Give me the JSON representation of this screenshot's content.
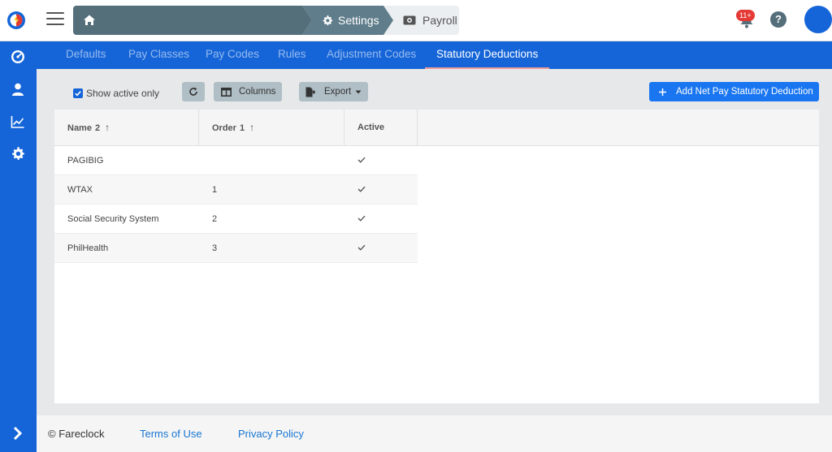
{
  "header": {
    "breadcrumb": [
      {
        "label": "",
        "icon": "home-icon"
      },
      {
        "label": "Settings",
        "icon": "gear-icon"
      },
      {
        "label": "Payroll",
        "icon": "money-icon"
      }
    ],
    "notifications_badge": "11+",
    "help_label": "?"
  },
  "sidebar": {
    "items": [
      {
        "icon": "dashboard-icon"
      },
      {
        "icon": "user-icon"
      },
      {
        "icon": "reports-chart-icon"
      },
      {
        "icon": "settings-gear-icon"
      }
    ],
    "expand_icon": "chevron-right-icon"
  },
  "tabs": [
    {
      "label": "Defaults",
      "active": false
    },
    {
      "label": "Pay Classes",
      "active": false
    },
    {
      "label": "Pay Codes",
      "active": false
    },
    {
      "label": "Rules",
      "active": false
    },
    {
      "label": "Adjustment Codes",
      "active": false
    },
    {
      "label": "Statutory Deductions",
      "active": true
    }
  ],
  "toolbar": {
    "show_active_label": "Show active only",
    "show_active_checked": true,
    "columns_label": "Columns",
    "export_label": "Export",
    "add_label": "Add Net Pay Statutory Deduction"
  },
  "grid": {
    "columns": [
      {
        "label": "Name",
        "sort_rank": "2",
        "sort_dir": "asc"
      },
      {
        "label": "Order",
        "sort_rank": "1",
        "sort_dir": "asc"
      },
      {
        "label": "Active",
        "sort_rank": "",
        "sort_dir": ""
      }
    ],
    "rows": [
      {
        "name": "PAGIBIG",
        "order": "",
        "active": true
      },
      {
        "name": "WTAX",
        "order": "1",
        "active": true
      },
      {
        "name": "Social Security System",
        "order": "2",
        "active": true
      },
      {
        "name": "PhilHealth",
        "order": "3",
        "active": true
      }
    ]
  },
  "footer": {
    "copyright": "© Fareclock",
    "terms": "Terms of Use",
    "privacy": "Privacy Policy"
  },
  "colors": {
    "brand_blue": "#1565d8",
    "breadcrumb_dark": "#546e7a",
    "tab_active_underline": "#ef9a9a",
    "link_blue": "#1976d2",
    "badge_red": "#e53935"
  }
}
